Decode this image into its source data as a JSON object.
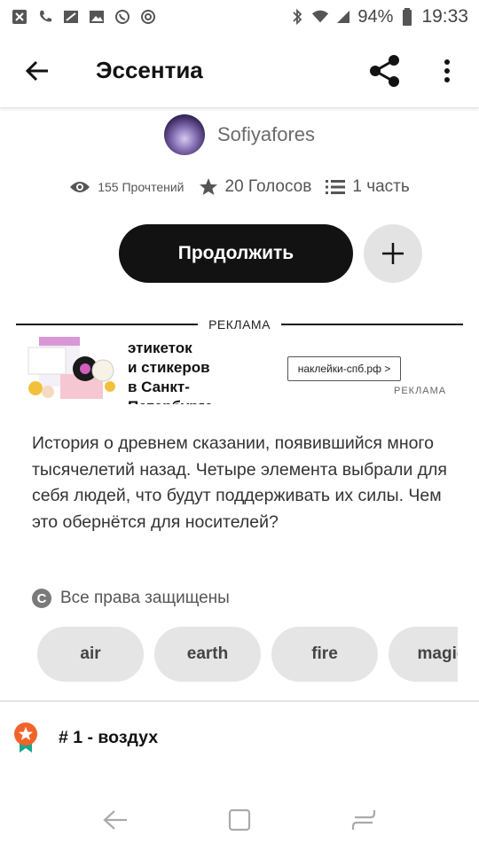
{
  "status_bar": {
    "battery": "94%",
    "time": "19:33",
    "left_icons": [
      "missed-call-icon",
      "phone-icon",
      "screenshot-icon",
      "image-icon",
      "whatsapp-icon",
      "settings-icon"
    ],
    "right_icons": [
      "bluetooth-icon",
      "wifi-icon",
      "signal-icon"
    ]
  },
  "app_bar": {
    "title": "Эссентиа"
  },
  "author": {
    "name": "Sofiyafores"
  },
  "stats": {
    "reads": "155 Прочтений",
    "votes": "20 Голосов",
    "parts": "1 часть"
  },
  "actions": {
    "continue_label": "Продолжить"
  },
  "ad": {
    "divider_label": "РЕКЛАМА",
    "text": "этикеток\nи стикеров\nв Санкт-\nПетербурге",
    "link_label": "наклейки-спб.рф >",
    "small_label": "РЕКЛАМА"
  },
  "description": "История о древнем сказании, появившийся много тысячелетий назад. Четыре элемента выбрали для себя людей, что будут поддерживать их силы. Чем это обернётся для носителей?",
  "rights": {
    "icon_letter": "C",
    "label": "Все права защищены"
  },
  "tags": [
    "air",
    "earth",
    "fire",
    "magic"
  ],
  "chapter": {
    "title": "# 1 - воздух"
  },
  "colors": {
    "primary_button": "#121212",
    "chip_bg": "#e5e5e5",
    "badge_orange": "#f2632a",
    "badge_teal": "#1aa88c"
  }
}
